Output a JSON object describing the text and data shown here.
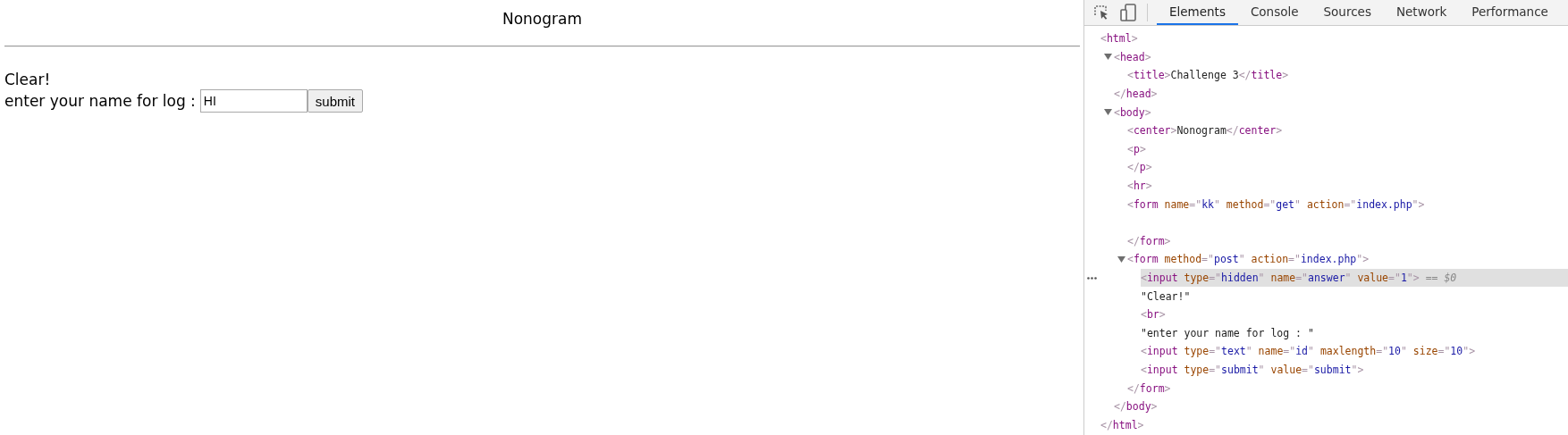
{
  "page": {
    "heading": "Nonogram",
    "message": "Clear!",
    "name_label": "enter your name for log :",
    "name_field": {
      "value": "HI"
    },
    "submit_button": "submit"
  },
  "devtools": {
    "tabs": [
      {
        "label": "Elements",
        "selected": true
      },
      {
        "label": "Console",
        "selected": false
      },
      {
        "label": "Sources",
        "selected": false
      },
      {
        "label": "Network",
        "selected": false
      },
      {
        "label": "Performance",
        "selected": false
      }
    ],
    "tree": [
      {
        "selected": false,
        "tokens": [
          {
            "kind": "punct",
            "text": "<"
          },
          {
            "kind": "tag",
            "text": "html"
          },
          {
            "kind": "punct",
            "text": ">"
          }
        ],
        "close": [
          {
            "kind": "punct",
            "text": "</"
          },
          {
            "kind": "tag",
            "text": "html"
          },
          {
            "kind": "punct",
            "text": ">"
          }
        ],
        "children": [
          {
            "expanded": true,
            "selected": false,
            "tokens": [
              {
                "kind": "punct",
                "text": "<"
              },
              {
                "kind": "tag",
                "text": "head"
              },
              {
                "kind": "punct",
                "text": ">"
              }
            ],
            "close": [
              {
                "kind": "punct",
                "text": "</"
              },
              {
                "kind": "tag",
                "text": "head"
              },
              {
                "kind": "punct",
                "text": ">"
              }
            ],
            "children": [
              {
                "selected": false,
                "tokens": [
                  {
                    "kind": "punct",
                    "text": "<"
                  },
                  {
                    "kind": "tag",
                    "text": "title"
                  },
                  {
                    "kind": "punct",
                    "text": ">"
                  },
                  {
                    "kind": "text",
                    "text": "Challenge 3"
                  },
                  {
                    "kind": "punct",
                    "text": "</"
                  },
                  {
                    "kind": "tag",
                    "text": "title"
                  },
                  {
                    "kind": "punct",
                    "text": ">"
                  }
                ]
              }
            ]
          },
          {
            "expanded": true,
            "selected": false,
            "tokens": [
              {
                "kind": "punct",
                "text": "<"
              },
              {
                "kind": "tag",
                "text": "body"
              },
              {
                "kind": "punct",
                "text": ">"
              }
            ],
            "close": [
              {
                "kind": "punct",
                "text": "</"
              },
              {
                "kind": "tag",
                "text": "body"
              },
              {
                "kind": "punct",
                "text": ">"
              }
            ],
            "children": [
              {
                "selected": false,
                "tokens": [
                  {
                    "kind": "punct",
                    "text": "<"
                  },
                  {
                    "kind": "tag",
                    "text": "center"
                  },
                  {
                    "kind": "punct",
                    "text": ">"
                  },
                  {
                    "kind": "text",
                    "text": "Nonogram"
                  },
                  {
                    "kind": "punct",
                    "text": "</"
                  },
                  {
                    "kind": "tag",
                    "text": "center"
                  },
                  {
                    "kind": "punct",
                    "text": ">"
                  }
                ]
              },
              {
                "selected": false,
                "tokens": [
                  {
                    "kind": "punct",
                    "text": "<"
                  },
                  {
                    "kind": "tag",
                    "text": "p"
                  },
                  {
                    "kind": "punct",
                    "text": ">"
                  }
                ],
                "close": [
                  {
                    "kind": "punct",
                    "text": "</"
                  },
                  {
                    "kind": "tag",
                    "text": "p"
                  },
                  {
                    "kind": "punct",
                    "text": ">"
                  }
                ]
              },
              {
                "selected": false,
                "tokens": [
                  {
                    "kind": "punct",
                    "text": "<"
                  },
                  {
                    "kind": "tag",
                    "text": "hr"
                  },
                  {
                    "kind": "punct",
                    "text": ">"
                  }
                ]
              },
              {
                "selected": false,
                "tokens": [
                  {
                    "kind": "punct",
                    "text": "<"
                  },
                  {
                    "kind": "tag",
                    "text": "form"
                  },
                  {
                    "kind": "attr",
                    "text": " name"
                  },
                  {
                    "kind": "punct",
                    "text": "=\""
                  },
                  {
                    "kind": "value",
                    "text": "kk"
                  },
                  {
                    "kind": "punct",
                    "text": "\""
                  },
                  {
                    "kind": "attr",
                    "text": " method"
                  },
                  {
                    "kind": "punct",
                    "text": "=\""
                  },
                  {
                    "kind": "value",
                    "text": "get"
                  },
                  {
                    "kind": "punct",
                    "text": "\""
                  },
                  {
                    "kind": "attr",
                    "text": " action"
                  },
                  {
                    "kind": "punct",
                    "text": "=\""
                  },
                  {
                    "kind": "value",
                    "text": "index.php"
                  },
                  {
                    "kind": "punct",
                    "text": "\">"
                  }
                ],
                "blank_line": true,
                "close": [
                  {
                    "kind": "punct",
                    "text": "</"
                  },
                  {
                    "kind": "tag",
                    "text": "form"
                  },
                  {
                    "kind": "punct",
                    "text": ">"
                  }
                ]
              },
              {
                "expanded": true,
                "selected": false,
                "tokens": [
                  {
                    "kind": "punct",
                    "text": "<"
                  },
                  {
                    "kind": "tag",
                    "text": "form"
                  },
                  {
                    "kind": "attr",
                    "text": " method"
                  },
                  {
                    "kind": "punct",
                    "text": "=\""
                  },
                  {
                    "kind": "value",
                    "text": "post"
                  },
                  {
                    "kind": "punct",
                    "text": "\""
                  },
                  {
                    "kind": "attr",
                    "text": " action"
                  },
                  {
                    "kind": "punct",
                    "text": "=\""
                  },
                  {
                    "kind": "value",
                    "text": "index.php"
                  },
                  {
                    "kind": "punct",
                    "text": "\">"
                  }
                ],
                "close": [
                  {
                    "kind": "punct",
                    "text": "</"
                  },
                  {
                    "kind": "tag",
                    "text": "form"
                  },
                  {
                    "kind": "punct",
                    "text": ">"
                  }
                ],
                "children": [
                  {
                    "selected": true,
                    "tokens": [
                      {
                        "kind": "punct",
                        "text": "<"
                      },
                      {
                        "kind": "tag",
                        "text": "input"
                      },
                      {
                        "kind": "attr",
                        "text": " type"
                      },
                      {
                        "kind": "punct",
                        "text": "=\""
                      },
                      {
                        "kind": "value",
                        "text": "hidden"
                      },
                      {
                        "kind": "punct",
                        "text": "\""
                      },
                      {
                        "kind": "attr",
                        "text": " name"
                      },
                      {
                        "kind": "punct",
                        "text": "=\""
                      },
                      {
                        "kind": "value",
                        "text": "answer"
                      },
                      {
                        "kind": "punct",
                        "text": "\""
                      },
                      {
                        "kind": "attr",
                        "text": " value"
                      },
                      {
                        "kind": "punct",
                        "text": "=\""
                      },
                      {
                        "kind": "value",
                        "text": "1"
                      },
                      {
                        "kind": "punct",
                        "text": "\">"
                      },
                      {
                        "kind": "hint",
                        "text": " == $0"
                      }
                    ]
                  },
                  {
                    "selected": false,
                    "tokens": [
                      {
                        "kind": "text",
                        "text": "\"Clear!\""
                      }
                    ]
                  },
                  {
                    "selected": false,
                    "tokens": [
                      {
                        "kind": "punct",
                        "text": "<"
                      },
                      {
                        "kind": "tag",
                        "text": "br"
                      },
                      {
                        "kind": "punct",
                        "text": ">"
                      }
                    ]
                  },
                  {
                    "selected": false,
                    "tokens": [
                      {
                        "kind": "text",
                        "text": "\"enter your name for log : \""
                      }
                    ]
                  },
                  {
                    "selected": false,
                    "tokens": [
                      {
                        "kind": "punct",
                        "text": "<"
                      },
                      {
                        "kind": "tag",
                        "text": "input"
                      },
                      {
                        "kind": "attr",
                        "text": " type"
                      },
                      {
                        "kind": "punct",
                        "text": "=\""
                      },
                      {
                        "kind": "value",
                        "text": "text"
                      },
                      {
                        "kind": "punct",
                        "text": "\""
                      },
                      {
                        "kind": "attr",
                        "text": " name"
                      },
                      {
                        "kind": "punct",
                        "text": "=\""
                      },
                      {
                        "kind": "value",
                        "text": "id"
                      },
                      {
                        "kind": "punct",
                        "text": "\""
                      },
                      {
                        "kind": "attr",
                        "text": " maxlength"
                      },
                      {
                        "kind": "punct",
                        "text": "=\""
                      },
                      {
                        "kind": "value",
                        "text": "10"
                      },
                      {
                        "kind": "punct",
                        "text": "\""
                      },
                      {
                        "kind": "attr",
                        "text": " size"
                      },
                      {
                        "kind": "punct",
                        "text": "=\""
                      },
                      {
                        "kind": "value",
                        "text": "10"
                      },
                      {
                        "kind": "punct",
                        "text": "\">"
                      }
                    ]
                  },
                  {
                    "selected": false,
                    "tokens": [
                      {
                        "kind": "punct",
                        "text": "<"
                      },
                      {
                        "kind": "tag",
                        "text": "input"
                      },
                      {
                        "kind": "attr",
                        "text": " type"
                      },
                      {
                        "kind": "punct",
                        "text": "=\""
                      },
                      {
                        "kind": "value",
                        "text": "submit"
                      },
                      {
                        "kind": "punct",
                        "text": "\""
                      },
                      {
                        "kind": "attr",
                        "text": " value"
                      },
                      {
                        "kind": "punct",
                        "text": "=\""
                      },
                      {
                        "kind": "value",
                        "text": "submit"
                      },
                      {
                        "kind": "punct",
                        "text": "\">"
                      }
                    ]
                  }
                ]
              }
            ]
          }
        ]
      }
    ]
  }
}
